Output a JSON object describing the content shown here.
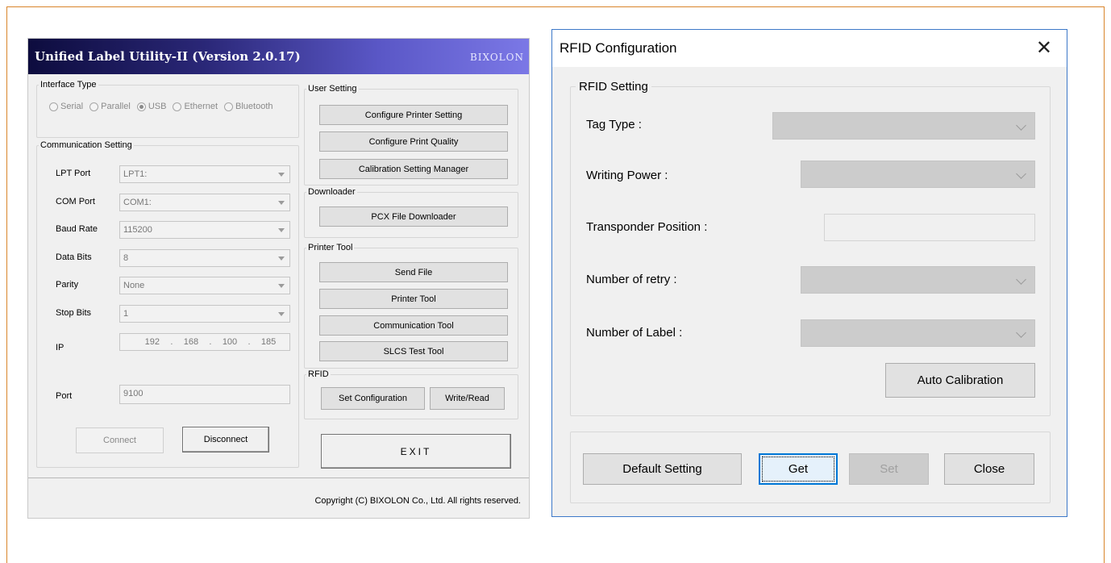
{
  "left_window": {
    "title": "Unified Label Utility-II (Version 2.0.17)",
    "brand": "BIXOLON",
    "interface_type": {
      "legend": "Interface Type",
      "options": [
        {
          "label": "Serial",
          "selected": false
        },
        {
          "label": "Parallel",
          "selected": false
        },
        {
          "label": "USB",
          "selected": true
        },
        {
          "label": "Ethernet",
          "selected": false
        },
        {
          "label": "Bluetooth",
          "selected": false
        }
      ]
    },
    "communication": {
      "legend": "Communication Setting",
      "lpt_label": "LPT Port",
      "lpt_value": "LPT1:",
      "com_label": "COM Port",
      "com_value": "COM1:",
      "baud_label": "Baud Rate",
      "baud_value": "115200",
      "databits_label": "Data Bits",
      "databits_value": "8",
      "parity_label": "Parity",
      "parity_value": "None",
      "stopbits_label": "Stop Bits",
      "stopbits_value": "1",
      "ip_label": "IP",
      "ip_octets": [
        "192",
        ".",
        "168",
        ".",
        "100",
        ".",
        "185"
      ],
      "port_label": "Port",
      "port_value": "9100",
      "connect_label": "Connect",
      "disconnect_label": "Disconnect"
    },
    "user_setting": {
      "legend": "User Setting",
      "configure_printer": "Configure Printer Setting",
      "configure_quality": "Configure Print Quality",
      "calibration_manager": "Calibration Setting Manager"
    },
    "downloader": {
      "legend": "Downloader",
      "pcx": "PCX File Downloader"
    },
    "printer_tool": {
      "legend": "Printer Tool",
      "send_file": "Send File",
      "printer_tool": "Printer Tool",
      "communication_tool": "Communication Tool",
      "slcs_test": "SLCS Test Tool"
    },
    "rfid": {
      "legend": "RFID",
      "set_configuration": "Set Configuration",
      "write_read": "Write/Read"
    },
    "exit_label": "EXIT",
    "copyright": "Copyright (C) BIXOLON Co., Ltd. All rights reserved."
  },
  "rfid_dialog": {
    "title": "RFID Configuration",
    "close_glyph": "✕",
    "setting_legend": "RFID Setting",
    "tag_type_label": "Tag Type :",
    "writing_power_label": "Writing Power :",
    "transponder_label": "Transponder Position :",
    "retry_label": "Number of retry :",
    "label_count_label": "Number of Label :",
    "auto_calibration": "Auto Calibration",
    "default_setting": "Default Setting",
    "get": "Get",
    "set": "Set",
    "close": "Close"
  }
}
